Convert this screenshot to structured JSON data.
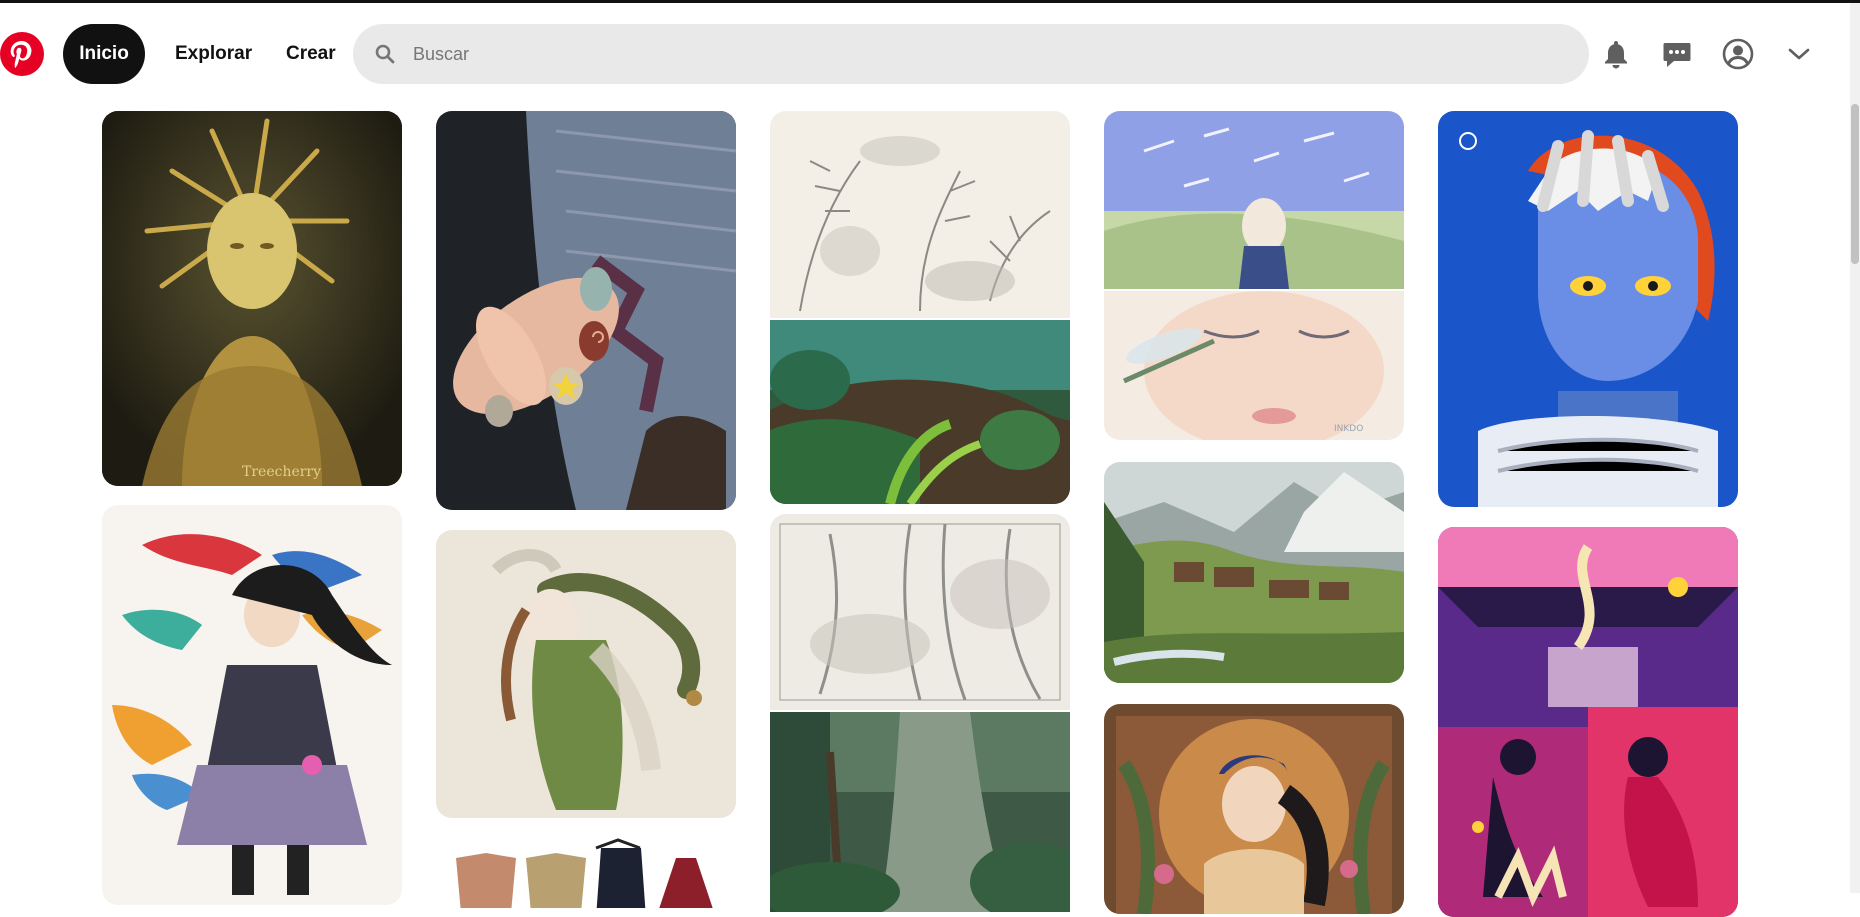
{
  "header": {
    "logo_icon": "pinterest-logo-icon",
    "nav": {
      "home": "Inicio",
      "explore": "Explorar",
      "create": "Crear"
    },
    "search": {
      "placeholder": "Buscar",
      "value": ""
    },
    "icons": [
      "bell-icon",
      "messages-icon",
      "profile-icon",
      "chevron-down-icon"
    ]
  },
  "colors": {
    "brand": "#e60023",
    "active_nav": "#111111",
    "search_bg": "#e9e9e9"
  },
  "pins": {
    "signature_1": "Treecherry",
    "watermark_1": "INKDO"
  }
}
